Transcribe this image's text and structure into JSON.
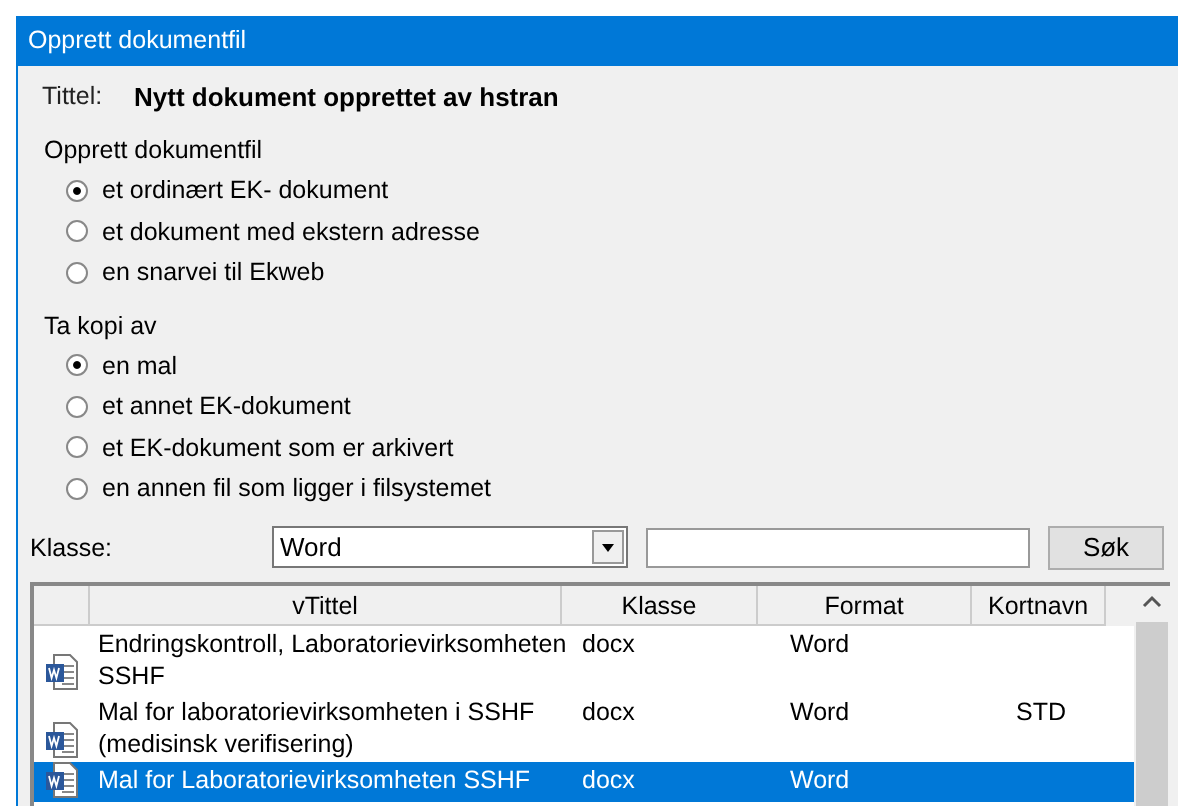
{
  "window": {
    "title": "Opprett dokumentfil"
  },
  "title_field": {
    "label": "Tittel:",
    "value": "Nytt dokument opprettet av hstran"
  },
  "groups": [
    {
      "heading": "Opprett dokumentfil",
      "options": [
        {
          "label": "et ordinært EK- dokument",
          "selected": true
        },
        {
          "label": "et dokument med ekstern adresse",
          "selected": false
        },
        {
          "label": "en snarvei til Ekweb",
          "selected": false
        }
      ]
    },
    {
      "heading": "Ta kopi av",
      "options": [
        {
          "label": "en mal",
          "selected": true
        },
        {
          "label": "et annet EK-dokument",
          "selected": false
        },
        {
          "label": "et EK-dokument som er arkivert",
          "selected": false
        },
        {
          "label": "en annen fil som ligger i filsystemet",
          "selected": false
        }
      ]
    }
  ],
  "filter": {
    "label": "Klasse:",
    "dropdown_value": "Word",
    "search_button": "Søk"
  },
  "table": {
    "columns": [
      "vTittel",
      "Klasse",
      "Format",
      "Kortnavn"
    ],
    "rows": [
      {
        "title": "Endringskontroll, Laboratorievirksomheten SSHF",
        "klasse": "docx",
        "format": "Word",
        "kortnavn": "",
        "selected": false
      },
      {
        "title": "Mal for laboratorievirksomheten i SSHF (medisinsk verifisering)",
        "klasse": "docx",
        "format": "Word",
        "kortnavn": "STD",
        "selected": false
      },
      {
        "title": "Mal for Laboratorievirksomheten SSHF",
        "klasse": "docx",
        "format": "Word",
        "kortnavn": "",
        "selected": true
      }
    ]
  }
}
